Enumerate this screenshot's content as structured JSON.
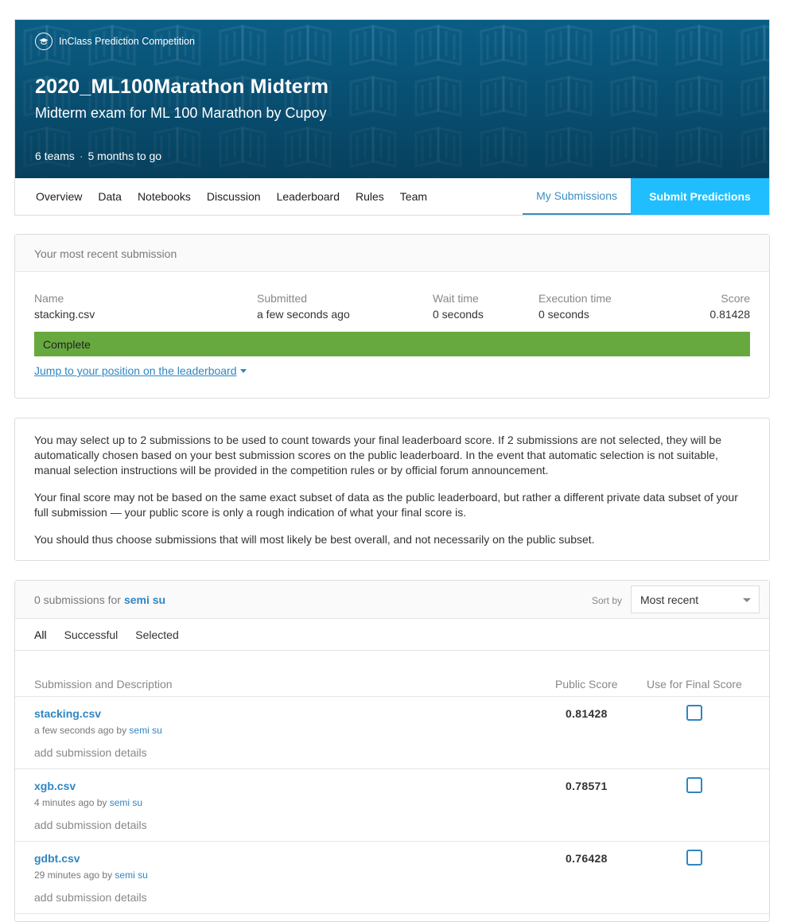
{
  "header": {
    "badge": "InClass Prediction Competition",
    "title": "2020_ML100Marathon Midterm",
    "subtitle": "Midterm exam for ML 100 Marathon by Cupoy",
    "teams": "6 teams",
    "time_left": "5 months to go"
  },
  "tabs": [
    "Overview",
    "Data",
    "Notebooks",
    "Discussion",
    "Leaderboard",
    "Rules",
    "Team"
  ],
  "my_submissions_tab": "My Submissions",
  "submit_button": "Submit Predictions",
  "recent": {
    "heading": "Your most recent submission",
    "name_label": "Name",
    "name": "stacking.csv",
    "submitted_label": "Submitted",
    "submitted": "a few seconds ago",
    "wait_label": "Wait time",
    "wait": "0 seconds",
    "exec_label": "Execution time",
    "exec": "0 seconds",
    "score_label": "Score",
    "score": "0.81428",
    "status": "Complete",
    "status_color": "#67a93f",
    "jump_link": "Jump to your position on the leaderboard"
  },
  "info": {
    "p1": "You may select up to 2 submissions to be used to count towards your final leaderboard score. If 2 submissions are not selected, they will be automatically chosen based on your best submission scores on the public leaderboard. In the event that automatic selection is not suitable, manual selection instructions will be provided in the competition rules or by official forum announcement.",
    "p2": "Your final score may not be based on the same exact subset of data as the public leaderboard, but rather a different private data subset of your full submission — your public score is only a rough indication of what your final score is.",
    "p3": "You should thus choose submissions that will most likely be best overall, and not necessarily on the public subset."
  },
  "list": {
    "count_text": "0 submissions for",
    "user": "semi su",
    "sort_label": "Sort by",
    "sort_value": "Most recent",
    "filters": [
      "All",
      "Successful",
      "Selected"
    ],
    "col_submission": "Submission and Description",
    "col_public": "Public Score",
    "col_final": "Use for Final Score",
    "rows": [
      {
        "file": "stacking.csv",
        "when": "a few seconds ago by",
        "user": "semi su",
        "details": "add submission details",
        "score": "0.81428"
      },
      {
        "file": "xgb.csv",
        "when": "4 minutes ago by",
        "user": "semi su",
        "details": "add submission details",
        "score": "0.78571"
      },
      {
        "file": "gdbt.csv",
        "when": "29 minutes ago by",
        "user": "semi su",
        "details": "add submission details",
        "score": "0.76428"
      }
    ]
  }
}
